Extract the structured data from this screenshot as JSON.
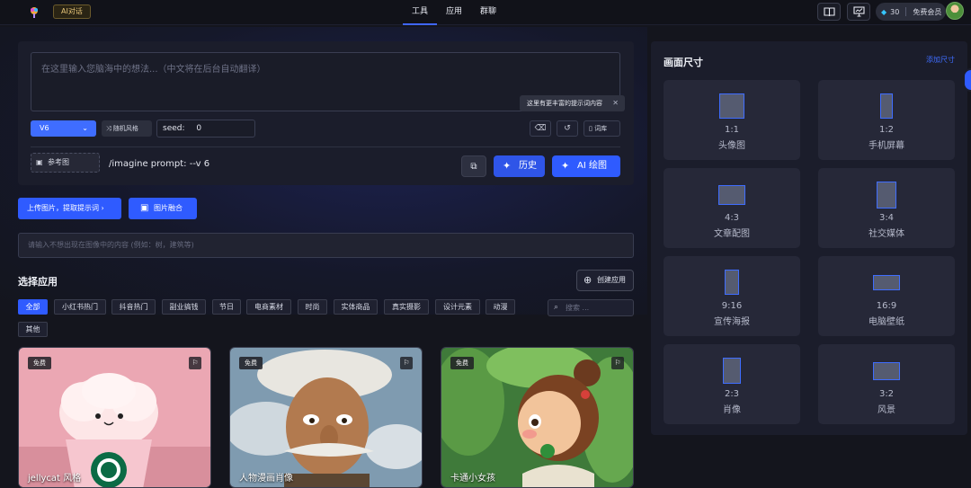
{
  "header": {
    "ai_badge": "AI对话",
    "nav": [
      "工具",
      "应用",
      "群聊"
    ],
    "credits": "30",
    "membership": "免费会员"
  },
  "prompt": {
    "placeholder": "在这里输入您脑海中的想法...（中文将在后台自动翻译）",
    "tooltip": "这里有更丰富的提示词内容",
    "version": "V6",
    "random_style": "随机风格",
    "seed_label": "seed:",
    "seed_value": "0",
    "dictionary": "词库",
    "ref_image": "参考图",
    "imagine_text": "/imagine prompt:  --v 6",
    "history": "历史",
    "ai_draw": "AI 绘图"
  },
  "actions": {
    "upload": "上传图片，提取提示词 ›",
    "fusion": "图片融合",
    "negative_placeholder": "请输入不想出现在图像中的内容 (例如：树，建筑等)"
  },
  "apps": {
    "title": "选择应用",
    "create": "创建应用",
    "search_placeholder": "搜索 ...",
    "filters": [
      "全部",
      "小红书热门",
      "抖音热门",
      "副业搞钱",
      "节日",
      "电商素材",
      "时尚",
      "实体商品",
      "真实摄影",
      "设计元素",
      "动漫",
      "其他"
    ],
    "cards": [
      {
        "badge": "免费",
        "title": "jellycat 风格"
      },
      {
        "badge": "免费",
        "title": "人物漫画肖像"
      },
      {
        "badge": "免费",
        "title": "卡通小女孩"
      }
    ]
  },
  "sizes": {
    "title": "画面尺寸",
    "add": "添加尺寸",
    "items": [
      {
        "ratio": "1:1",
        "label": "头像图"
      },
      {
        "ratio": "1:2",
        "label": "手机屏幕"
      },
      {
        "ratio": "4:3",
        "label": "文章配图"
      },
      {
        "ratio": "3:4",
        "label": "社交媒体"
      },
      {
        "ratio": "9:16",
        "label": "宣传海报"
      },
      {
        "ratio": "16:9",
        "label": "电脑壁纸"
      },
      {
        "ratio": "2:3",
        "label": "肖像"
      },
      {
        "ratio": "3:2",
        "label": "风景"
      }
    ]
  },
  "colors": {
    "accent": "#2f5bff",
    "panel": "#1b1d2b",
    "background": "#14151d"
  }
}
